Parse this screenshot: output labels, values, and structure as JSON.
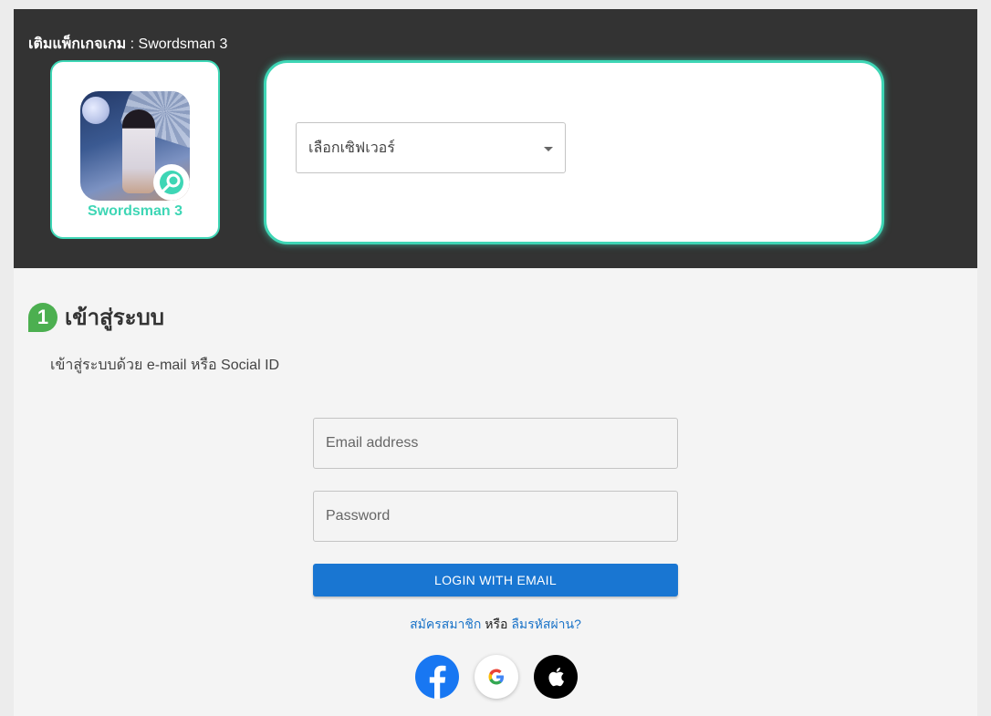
{
  "header": {
    "label": "เติมแพ็กเกจเกม",
    "separator": " : ",
    "game_title": "Swordsman 3"
  },
  "game_card": {
    "name": "Swordsman 3"
  },
  "server_select": {
    "placeholder": "เลือกเซิฟเวอร์"
  },
  "login": {
    "step_number": "1",
    "title": "เข้าสู่ระบบ",
    "description": "เข้าสู่ระบบด้วย e-mail หรือ Social ID",
    "email_placeholder": "Email address",
    "password_placeholder": "Password",
    "login_button": "LOGIN WITH EMAIL",
    "register_link": "สมัครสมาชิก",
    "or_text": "หรือ",
    "forgot_link": "ลืมรหัสผ่าน?",
    "socials": [
      "facebook-icon",
      "google-icon",
      "apple-icon"
    ]
  },
  "colors": {
    "accent": "#3ed6b5",
    "primary_button": "#1976d2",
    "step_badge": "#4caf50",
    "header_bg": "#333333"
  }
}
